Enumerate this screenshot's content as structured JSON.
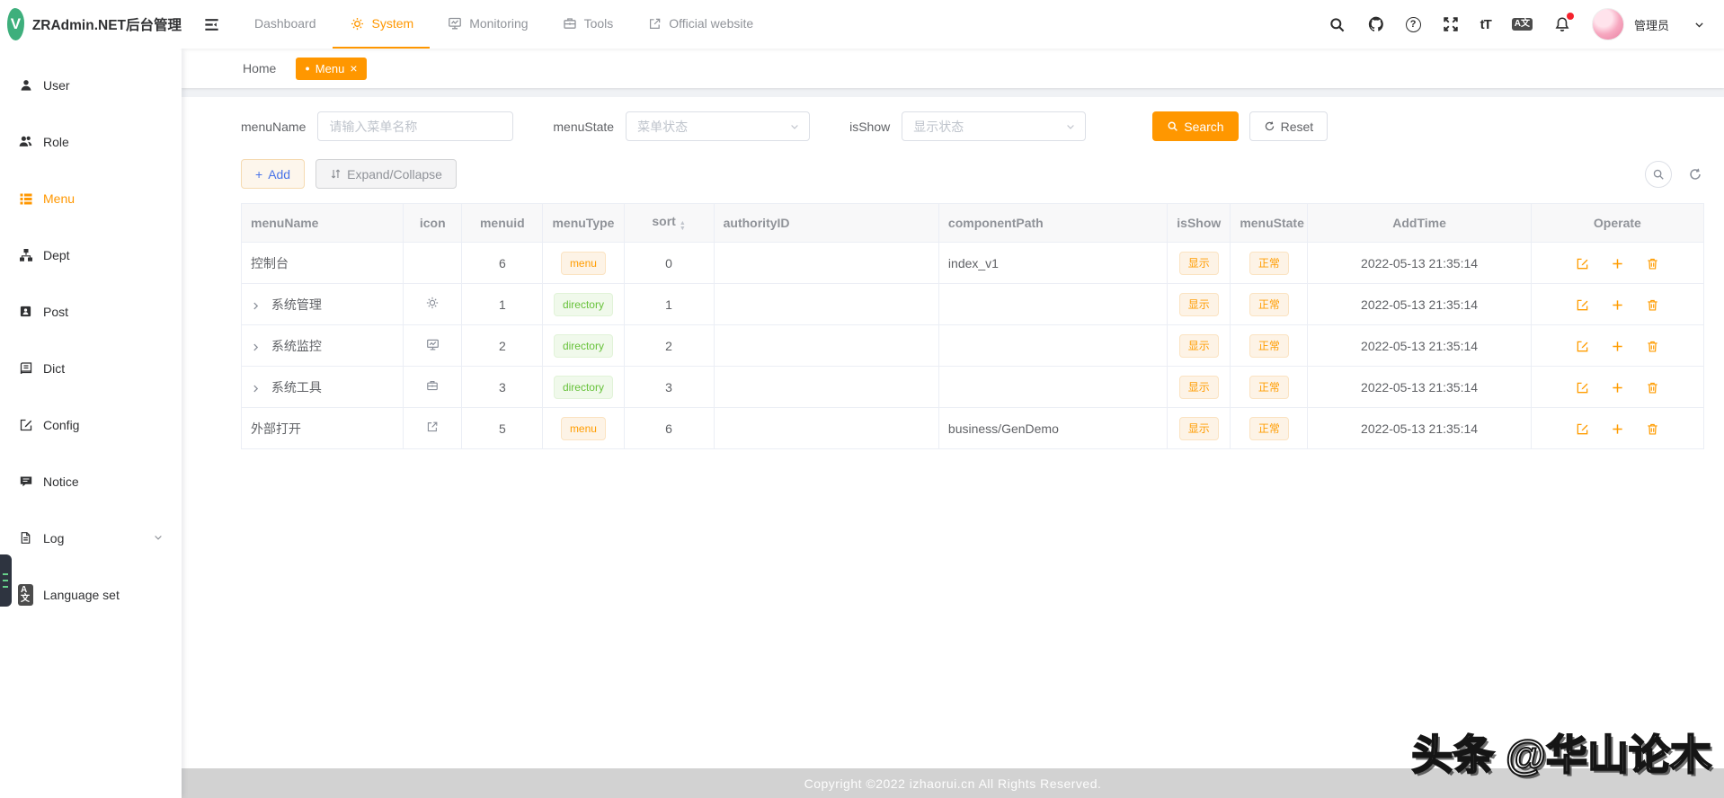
{
  "brand": {
    "title": "ZRAdmin.NET后台管理",
    "logo_letter": "V"
  },
  "topnav": {
    "items": [
      {
        "label": "Dashboard",
        "icon": "",
        "active": false
      },
      {
        "label": "System",
        "icon": "gear-icon",
        "active": true
      },
      {
        "label": "Monitoring",
        "icon": "monitor-icon",
        "active": false
      },
      {
        "label": "Tools",
        "icon": "toolbox-icon",
        "active": false
      },
      {
        "label": "Official website",
        "icon": "external-link-icon",
        "active": false
      }
    ]
  },
  "header_actions": {
    "icons": [
      "search-icon",
      "github-icon",
      "help-icon",
      "fullscreen-icon",
      "font-size-icon",
      "translate-icon",
      "bell-icon"
    ],
    "user_name": "管理员"
  },
  "sidebar": {
    "items": [
      {
        "label": "User",
        "icon": "user-icon",
        "active": false
      },
      {
        "label": "Role",
        "icon": "role-icon",
        "active": false
      },
      {
        "label": "Menu",
        "icon": "menu-list-icon",
        "active": true
      },
      {
        "label": "Dept",
        "icon": "dept-tree-icon",
        "active": false
      },
      {
        "label": "Post",
        "icon": "post-badge-icon",
        "active": false
      },
      {
        "label": "Dict",
        "icon": "dict-book-icon",
        "active": false
      },
      {
        "label": "Config",
        "icon": "config-edit-icon",
        "active": false
      },
      {
        "label": "Notice",
        "icon": "notice-bubble-icon",
        "active": false
      },
      {
        "label": "Log",
        "icon": "log-file-icon",
        "active": false,
        "has_submenu": true
      },
      {
        "label": "Language set",
        "icon": "language-icon",
        "active": false
      }
    ]
  },
  "tabs": [
    {
      "label": "Home",
      "active": false
    },
    {
      "label": "Menu",
      "active": true,
      "closable": true
    }
  ],
  "filters": {
    "menu_name": {
      "label": "menuName",
      "placeholder": "请输入菜单名称"
    },
    "menu_state": {
      "label": "menuState",
      "placeholder": "菜单状态"
    },
    "is_show": {
      "label": "isShow",
      "placeholder": "显示状态"
    },
    "search_label": "Search",
    "reset_label": "Reset"
  },
  "toolbar": {
    "add_label": "Add",
    "expand_label": "Expand/Collapse"
  },
  "table": {
    "columns": [
      "menuName",
      "icon",
      "menuid",
      "menuType",
      "sort",
      "authorityID",
      "componentPath",
      "isShow",
      "menuState",
      "AddTime",
      "Operate"
    ],
    "rows": [
      {
        "menuName": "控制台",
        "icon": "",
        "menuid": "6",
        "menuType": "menu",
        "sort": "0",
        "authorityID": "",
        "componentPath": "index_v1",
        "isShow": "显示",
        "menuState": "正常",
        "addTime": "2022-05-13 21:35:14",
        "expandable": false
      },
      {
        "menuName": "系统管理",
        "icon": "gear-icon",
        "menuid": "1",
        "menuType": "directory",
        "sort": "1",
        "authorityID": "",
        "componentPath": "",
        "isShow": "显示",
        "menuState": "正常",
        "addTime": "2022-05-13 21:35:14",
        "expandable": true
      },
      {
        "menuName": "系统监控",
        "icon": "monitor-icon",
        "menuid": "2",
        "menuType": "directory",
        "sort": "2",
        "authorityID": "",
        "componentPath": "",
        "isShow": "显示",
        "menuState": "正常",
        "addTime": "2022-05-13 21:35:14",
        "expandable": true
      },
      {
        "menuName": "系统工具",
        "icon": "toolbox-icon",
        "menuid": "3",
        "menuType": "directory",
        "sort": "3",
        "authorityID": "",
        "componentPath": "",
        "isShow": "显示",
        "menuState": "正常",
        "addTime": "2022-05-13 21:35:14",
        "expandable": true
      },
      {
        "menuName": "外部打开",
        "icon": "external-link-icon",
        "menuid": "5",
        "menuType": "menu",
        "sort": "6",
        "authorityID": "",
        "componentPath": "business/GenDemo",
        "isShow": "显示",
        "menuState": "正常",
        "addTime": "2022-05-13 21:35:14",
        "expandable": false
      }
    ]
  },
  "footer": {
    "copyright": "Copyright ©2022 izhaorui.cn All Rights Reserved."
  },
  "watermark": {
    "text": "头条 @华山论木"
  },
  "glyphs": {
    "dot": "●",
    "close": "×",
    "plus": "+",
    "question": "?",
    "font_size": "tT",
    "translate": "A文",
    "caret_up": "▲",
    "caret_down": "▼"
  },
  "colors": {
    "accent": "#ff9700",
    "logo_green": "#3eaf7c",
    "tag_green": "#67c23a",
    "add_text_blue": "#4a74e8",
    "badge_red": "#f5222d"
  }
}
